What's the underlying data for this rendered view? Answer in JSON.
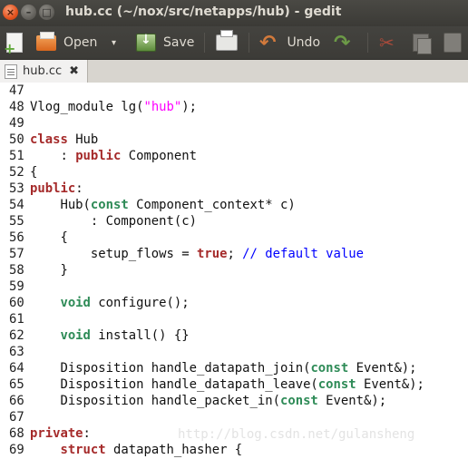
{
  "window": {
    "title": "hub.cc (~/nox/src/netapps/hub) - gedit",
    "controls": {
      "close": "×",
      "minimize": "–",
      "maximize": "□"
    }
  },
  "toolbar": {
    "new_icon": "new-document-icon",
    "open_label": "Open",
    "open_dropdown": "▾",
    "save_label": "Save",
    "print_icon": "printer-icon",
    "undo_label": "Undo",
    "redo_icon": "redo-icon",
    "cut_icon": "scissors-icon",
    "copy_icon": "copy-icon",
    "paste_icon": "paste-icon"
  },
  "tabs": [
    {
      "label": "hub.cc",
      "close": "✖"
    }
  ],
  "editor": {
    "lines": [
      {
        "num": "47",
        "tokens": []
      },
      {
        "num": "48",
        "tokens": [
          [
            "",
            "Vlog_module lg("
          ],
          [
            "st",
            "\"hub\""
          ],
          [
            "",
            ");"
          ]
        ]
      },
      {
        "num": "49",
        "tokens": []
      },
      {
        "num": "50",
        "tokens": [
          [
            "kw",
            "class"
          ],
          [
            "",
            " Hub"
          ]
        ]
      },
      {
        "num": "51",
        "tokens": [
          [
            "",
            "    : "
          ],
          [
            "kw",
            "public"
          ],
          [
            "",
            " Component"
          ]
        ]
      },
      {
        "num": "52",
        "tokens": [
          [
            "",
            "{"
          ]
        ]
      },
      {
        "num": "53",
        "tokens": [
          [
            "kw",
            "public"
          ],
          [
            "",
            ":"
          ]
        ]
      },
      {
        "num": "54",
        "tokens": [
          [
            "",
            "    Hub("
          ],
          [
            "ty",
            "const"
          ],
          [
            "",
            " Component_context* c)"
          ]
        ]
      },
      {
        "num": "55",
        "tokens": [
          [
            "",
            "        : Component(c)"
          ]
        ]
      },
      {
        "num": "56",
        "tokens": [
          [
            "",
            "    {"
          ]
        ]
      },
      {
        "num": "57",
        "tokens": [
          [
            "",
            "        setup_flows = "
          ],
          [
            "kw",
            "true"
          ],
          [
            "",
            "; "
          ],
          [
            "cm",
            "// default value"
          ]
        ]
      },
      {
        "num": "58",
        "tokens": [
          [
            "",
            "    }"
          ]
        ]
      },
      {
        "num": "59",
        "tokens": []
      },
      {
        "num": "60",
        "tokens": [
          [
            "",
            "    "
          ],
          [
            "ty",
            "void"
          ],
          [
            "",
            " configure();"
          ]
        ]
      },
      {
        "num": "61",
        "tokens": []
      },
      {
        "num": "62",
        "tokens": [
          [
            "",
            "    "
          ],
          [
            "ty",
            "void"
          ],
          [
            "",
            " install() {}"
          ]
        ]
      },
      {
        "num": "63",
        "tokens": []
      },
      {
        "num": "64",
        "tokens": [
          [
            "",
            "    Disposition handle_datapath_join("
          ],
          [
            "ty",
            "const"
          ],
          [
            "",
            " Event&);"
          ]
        ]
      },
      {
        "num": "65",
        "tokens": [
          [
            "",
            "    Disposition handle_datapath_leave("
          ],
          [
            "ty",
            "const"
          ],
          [
            "",
            " Event&);"
          ]
        ]
      },
      {
        "num": "66",
        "tokens": [
          [
            "",
            "    Disposition handle_packet_in("
          ],
          [
            "ty",
            "const"
          ],
          [
            "",
            " Event&);"
          ]
        ]
      },
      {
        "num": "67",
        "tokens": []
      },
      {
        "num": "68",
        "tokens": [
          [
            "kw",
            "private"
          ],
          [
            "",
            ":"
          ]
        ]
      },
      {
        "num": "69",
        "tokens": [
          [
            "",
            "    "
          ],
          [
            "kw",
            "struct"
          ],
          [
            "",
            " datapath_hasher {"
          ]
        ]
      }
    ]
  },
  "watermark": "http://blog.csdn.net/gulansheng",
  "colors": {
    "keyword": "#a52a2a",
    "type": "#2e8b57",
    "string": "#ff00ff",
    "comment": "#0000ff"
  }
}
